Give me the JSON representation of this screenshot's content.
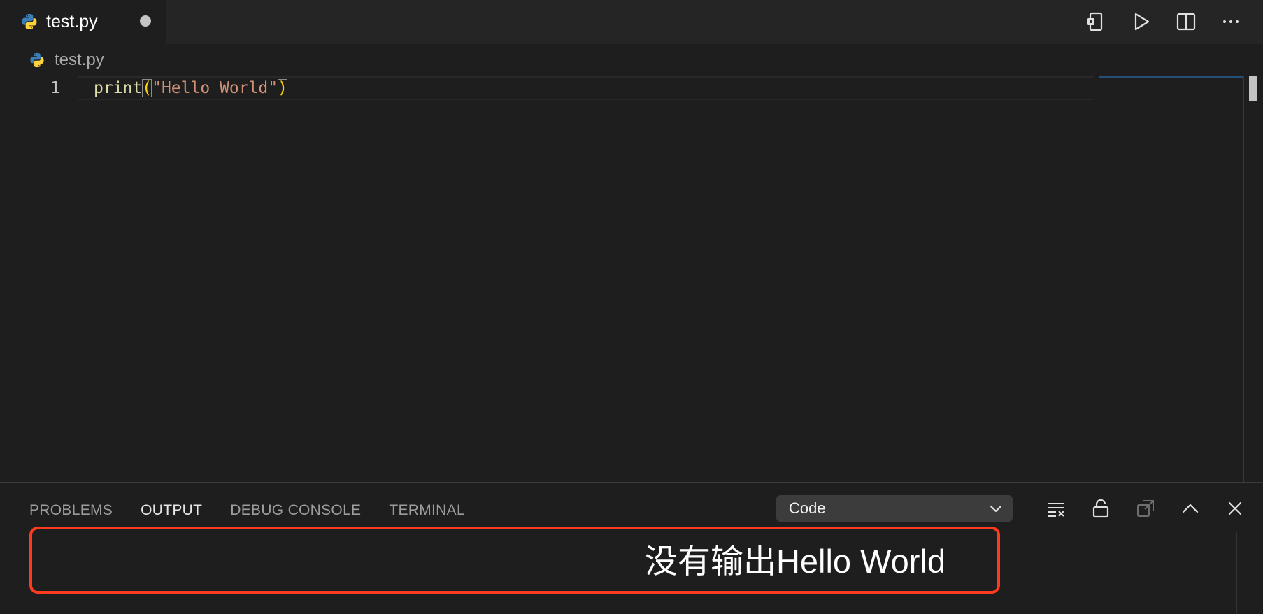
{
  "tab": {
    "label": "test.py",
    "icon": "python-icon"
  },
  "editor_actions": [
    {
      "name": "open-changes-icon"
    },
    {
      "name": "run-icon"
    },
    {
      "name": "split-editor-icon"
    },
    {
      "name": "more-actions-icon"
    }
  ],
  "breadcrumb": {
    "file": "test.py"
  },
  "editor": {
    "line_number": "1",
    "code": {
      "fn": "print",
      "open": "(",
      "str": "\"Hello World\"",
      "close": ")"
    }
  },
  "panel": {
    "tabs": [
      {
        "label": "PROBLEMS",
        "active": false
      },
      {
        "label": "OUTPUT",
        "active": true
      },
      {
        "label": "DEBUG CONSOLE",
        "active": false
      },
      {
        "label": "TERMINAL",
        "active": false
      }
    ],
    "output_channel": "Code",
    "actions": [
      "clear-output-icon",
      "unlock-icon",
      "open-in-editor-icon",
      "maximize-panel-icon",
      "close-panel-icon"
    ]
  },
  "annotation": {
    "text": "没有输出Hello World",
    "color": "#ff3b1f"
  },
  "colors": {
    "editor_bg": "#1e1e1e",
    "tabbar_bg": "#252526",
    "function": "#dcdcaa",
    "string": "#ce9178",
    "bracket": "#ffd700",
    "python_blue": "#3a7fb8",
    "python_yellow": "#ffd43b"
  }
}
